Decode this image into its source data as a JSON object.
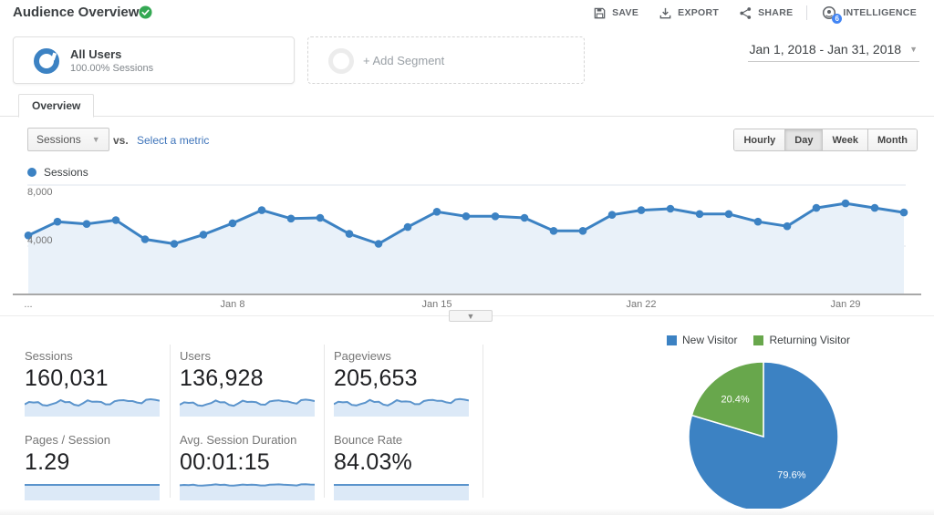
{
  "header": {
    "title": "Audience Overview",
    "actions": {
      "save": "SAVE",
      "export": "EXPORT",
      "share": "SHARE",
      "intelligence": "INTELLIGENCE",
      "intelligence_badge": "6"
    }
  },
  "segments": {
    "all_users_title": "All Users",
    "all_users_subtitle": "100.00% Sessions",
    "add_segment_label": "+ Add Segment"
  },
  "date_range": {
    "label": "Jan 1, 2018 - Jan 31, 2018"
  },
  "tabs": {
    "overview": "Overview"
  },
  "controls": {
    "metric_dropdown": "Sessions",
    "vs_label": "vs.",
    "select_metric_link": "Select a metric",
    "granularity": {
      "hourly": "Hourly",
      "day": "Day",
      "week": "Week",
      "month": "Month"
    },
    "granularity_active": "Day"
  },
  "chart_legend": {
    "label": "Sessions",
    "color": "#3c82c3"
  },
  "chart_data": [
    {
      "type": "line",
      "title": "Sessions by day, Jan 1 2018 - Jan 31 2018",
      "series": [
        {
          "name": "Sessions",
          "values": [
            4700,
            5600,
            5450,
            5700,
            4450,
            4150,
            4750,
            5500,
            6350,
            5800,
            5850,
            4800,
            4150,
            5250,
            6250,
            5950,
            5950,
            5850,
            5000,
            5000,
            6050,
            6350,
            6450,
            6100,
            6100,
            5600,
            5300,
            6500,
            6800,
            6500,
            6200
          ]
        }
      ],
      "xticks": [
        {
          "day": 1,
          "label": "..."
        },
        {
          "day": 8,
          "label": "Jan 8"
        },
        {
          "day": 15,
          "label": "Jan 15"
        },
        {
          "day": 22,
          "label": "Jan 22"
        },
        {
          "day": 29,
          "label": "Jan 29"
        }
      ],
      "yticks": [
        {
          "value": 8000,
          "label": "8,000"
        },
        {
          "value": 4000,
          "label": "4,000"
        }
      ],
      "ylim": [
        0,
        8400
      ],
      "grid": true,
      "line_color": "#3c82c3",
      "fill_color": "#e9f1f9"
    },
    {
      "type": "pie",
      "title": "New vs Returning Visitors",
      "labels": [
        "New Visitor",
        "Returning Visitor"
      ],
      "values": [
        79.6,
        20.4
      ],
      "value_labels": [
        "79.6%",
        "20.4%"
      ],
      "colors": [
        "#3c82c3",
        "#68a74c"
      ],
      "legend_position": "top"
    }
  ],
  "scorecards": {
    "cards": [
      {
        "label": "Sessions",
        "value": "160,031",
        "spark": [
          0.62,
          0.75,
          0.72,
          0.74,
          0.58,
          0.55,
          0.63,
          0.7,
          0.85,
          0.74,
          0.75,
          0.6,
          0.55,
          0.68,
          0.84,
          0.76,
          0.77,
          0.75,
          0.62,
          0.62,
          0.79,
          0.84,
          0.85,
          0.8,
          0.8,
          0.72,
          0.68,
          0.87,
          0.9,
          0.87,
          0.82
        ]
      },
      {
        "label": "Users",
        "value": "136,928",
        "spark": [
          0.6,
          0.73,
          0.7,
          0.72,
          0.57,
          0.54,
          0.62,
          0.69,
          0.83,
          0.73,
          0.74,
          0.59,
          0.54,
          0.67,
          0.82,
          0.75,
          0.76,
          0.74,
          0.61,
          0.6,
          0.78,
          0.82,
          0.84,
          0.79,
          0.78,
          0.71,
          0.66,
          0.85,
          0.88,
          0.85,
          0.8
        ]
      },
      {
        "label": "Pageviews",
        "value": "205,653",
        "spark": [
          0.63,
          0.76,
          0.73,
          0.75,
          0.59,
          0.56,
          0.64,
          0.71,
          0.86,
          0.75,
          0.76,
          0.61,
          0.56,
          0.69,
          0.85,
          0.77,
          0.78,
          0.76,
          0.63,
          0.63,
          0.8,
          0.85,
          0.86,
          0.81,
          0.81,
          0.73,
          0.69,
          0.88,
          0.91,
          0.88,
          0.83
        ]
      },
      {
        "label": "Pages / Session",
        "value": "1.29",
        "spark": [
          0.8,
          0.8,
          0.8,
          0.8,
          0.8,
          0.8,
          0.8,
          0.8,
          0.8,
          0.8,
          0.8,
          0.8,
          0.8,
          0.8,
          0.8,
          0.8,
          0.8,
          0.8,
          0.8,
          0.8,
          0.8,
          0.8,
          0.8,
          0.8,
          0.8,
          0.8,
          0.8,
          0.8,
          0.8,
          0.8,
          0.8
        ]
      },
      {
        "label": "Avg. Session Duration",
        "value": "00:01:15",
        "spark": [
          0.78,
          0.8,
          0.79,
          0.81,
          0.77,
          0.76,
          0.78,
          0.8,
          0.83,
          0.8,
          0.81,
          0.77,
          0.76,
          0.79,
          0.82,
          0.8,
          0.81,
          0.8,
          0.77,
          0.77,
          0.81,
          0.82,
          0.83,
          0.81,
          0.8,
          0.79,
          0.77,
          0.83,
          0.84,
          0.82,
          0.81
        ]
      },
      {
        "label": "Bounce Rate",
        "value": "84.03%",
        "spark": [
          0.8,
          0.8,
          0.8,
          0.8,
          0.8,
          0.8,
          0.8,
          0.8,
          0.8,
          0.8,
          0.8,
          0.8,
          0.8,
          0.8,
          0.8,
          0.8,
          0.8,
          0.8,
          0.8,
          0.8,
          0.8,
          0.8,
          0.8,
          0.8,
          0.8,
          0.8,
          0.8,
          0.8,
          0.8,
          0.8,
          0.8
        ]
      }
    ]
  },
  "pie_legend": [
    {
      "label": "New Visitor",
      "color": "#3c82c3"
    },
    {
      "label": "Returning Visitor",
      "color": "#68a74c"
    }
  ]
}
